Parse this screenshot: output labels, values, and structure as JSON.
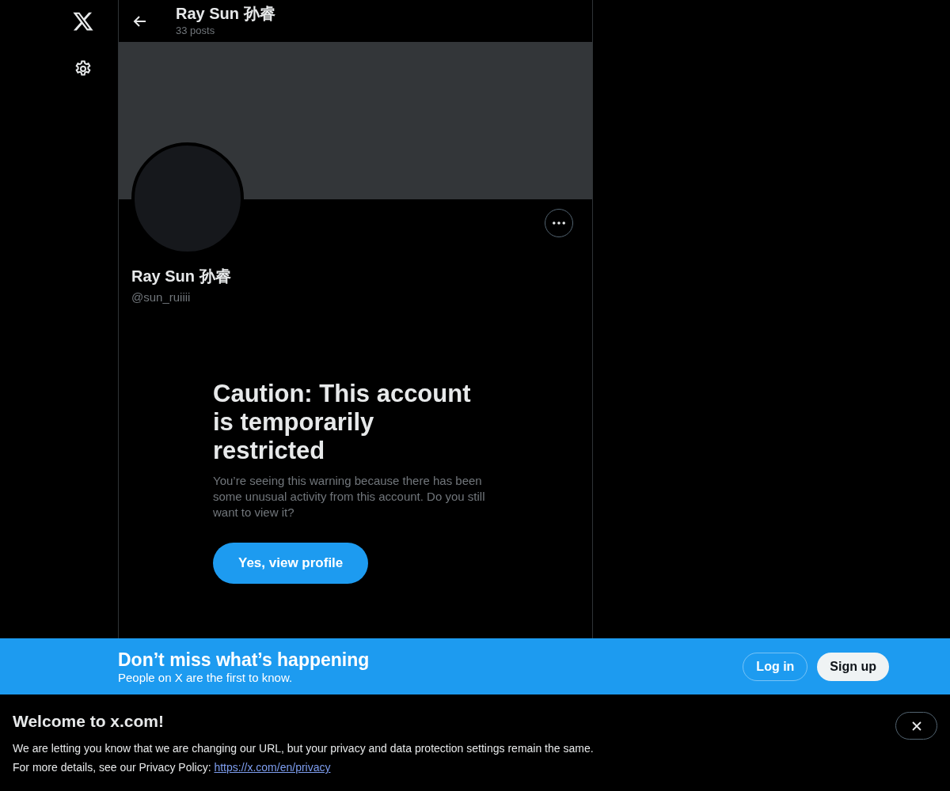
{
  "header": {
    "title": "Ray Sun 孙睿",
    "post_count": "33 posts"
  },
  "profile": {
    "name": "Ray Sun 孙睿",
    "handle": "@sun_ruiiii"
  },
  "warning": {
    "title": "Caution: This account is temporarily restricted",
    "body": "You’re seeing this warning because there has been some unusual activity from this account. Do you still want to view it?",
    "button": "Yes, view profile"
  },
  "signup_bar": {
    "title": "Don’t miss what’s happening",
    "subtitle": "People on X are the first to know.",
    "buttons": [
      {
        "label": "Log in",
        "kind": "outline"
      },
      {
        "label": "Sign up",
        "kind": "filled"
      }
    ]
  },
  "notice": {
    "title": "Welcome to x.com!",
    "text": "We are letting you know that we are changing our URL, but your privacy and data protection settings remain the same.",
    "link_prefix": "For more details, see our Privacy Policy:",
    "link": "https://x.com/en/privacy"
  }
}
